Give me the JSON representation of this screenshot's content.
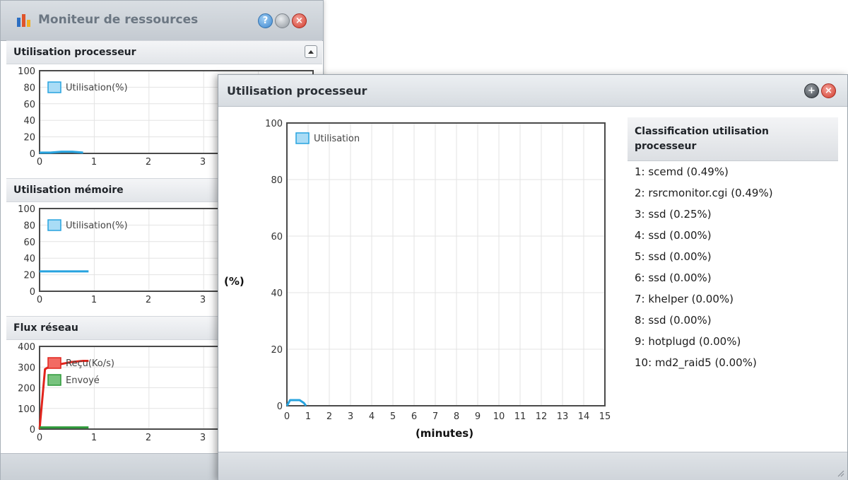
{
  "back_window": {
    "title": "Moniteur de ressources",
    "cpu_section": {
      "title": "Utilisation processeur",
      "chart_data": {
        "type": "line",
        "ylim": [
          0,
          100
        ],
        "yticks": [
          "100",
          "80",
          "60",
          "40",
          "20",
          "0"
        ],
        "xticks": [
          "0",
          "1",
          "2",
          "3"
        ],
        "legend": [
          "Utilisation(%)"
        ],
        "series": [
          {
            "name": "Utilisation(%)",
            "color": "#27a3df",
            "x": [
              0,
              0.2,
              0.4,
              0.6,
              0.8
            ],
            "values": [
              1,
              1,
              2,
              2,
              1
            ]
          }
        ]
      }
    },
    "memory_section": {
      "title": "Utilisation mémoire",
      "chart_data": {
        "type": "line",
        "ylim": [
          0,
          100
        ],
        "yticks": [
          "100",
          "80",
          "60",
          "40",
          "20",
          "0"
        ],
        "xticks": [
          "0",
          "1",
          "2",
          "3"
        ],
        "legend": [
          "Utilisation(%)"
        ],
        "series": [
          {
            "name": "Utilisation(%)",
            "color": "#27a3df",
            "x": [
              0,
              0.9
            ],
            "values": [
              24,
              24
            ]
          }
        ]
      }
    },
    "network_section": {
      "title": "Flux réseau",
      "chart_data": {
        "type": "line",
        "ylim": [
          0,
          400
        ],
        "yticks": [
          "400",
          "300",
          "200",
          "100",
          "0"
        ],
        "xticks": [
          "0",
          "1",
          "2",
          "3"
        ],
        "legend": [
          "Reçu(Ko/s)",
          "Envoyé"
        ],
        "series": [
          {
            "name": "Reçu(Ko/s)",
            "color": "#e1241c",
            "x": [
              0,
              0.1,
              0.2,
              0.4,
              0.6,
              0.8,
              0.9
            ],
            "values": [
              0,
              290,
              305,
              315,
              325,
              330,
              330
            ]
          },
          {
            "name": "Envoyé",
            "color": "#2f9a3a",
            "x": [
              0,
              0.9
            ],
            "values": [
              8,
              8
            ]
          }
        ]
      }
    }
  },
  "front_window": {
    "title": "Utilisation processeur",
    "chart_data": {
      "type": "line",
      "ylabel": "(%)",
      "xlabel": "(minutes)",
      "ylim": [
        0,
        100
      ],
      "xlim": [
        0,
        15
      ],
      "yticks": [
        "100",
        "80",
        "60",
        "40",
        "20",
        "0"
      ],
      "xticks": [
        "0",
        "1",
        "2",
        "3",
        "4",
        "5",
        "6",
        "7",
        "8",
        "9",
        "10",
        "11",
        "12",
        "13",
        "14",
        "15"
      ],
      "legend": [
        "Utilisation"
      ],
      "series": [
        {
          "name": "Utilisation",
          "color": "#27a3df",
          "x": [
            0,
            0.15,
            0.35,
            0.6,
            0.8,
            0.9
          ],
          "values": [
            0,
            2,
            2,
            2,
            1,
            0
          ]
        }
      ]
    },
    "ranking": {
      "title_line1": "Classification utilisation",
      "title_line2": "processeur",
      "items": [
        "1: scemd (0.49%)",
        "2: rsrcmonitor.cgi (0.49%)",
        "3: ssd (0.25%)",
        "4: ssd (0.00%)",
        "5: ssd (0.00%)",
        "6: ssd (0.00%)",
        "7: khelper (0.00%)",
        "8: ssd (0.00%)",
        "9: hotplugd (0.00%)",
        "10: md2_raid5 (0.00%)"
      ]
    }
  }
}
